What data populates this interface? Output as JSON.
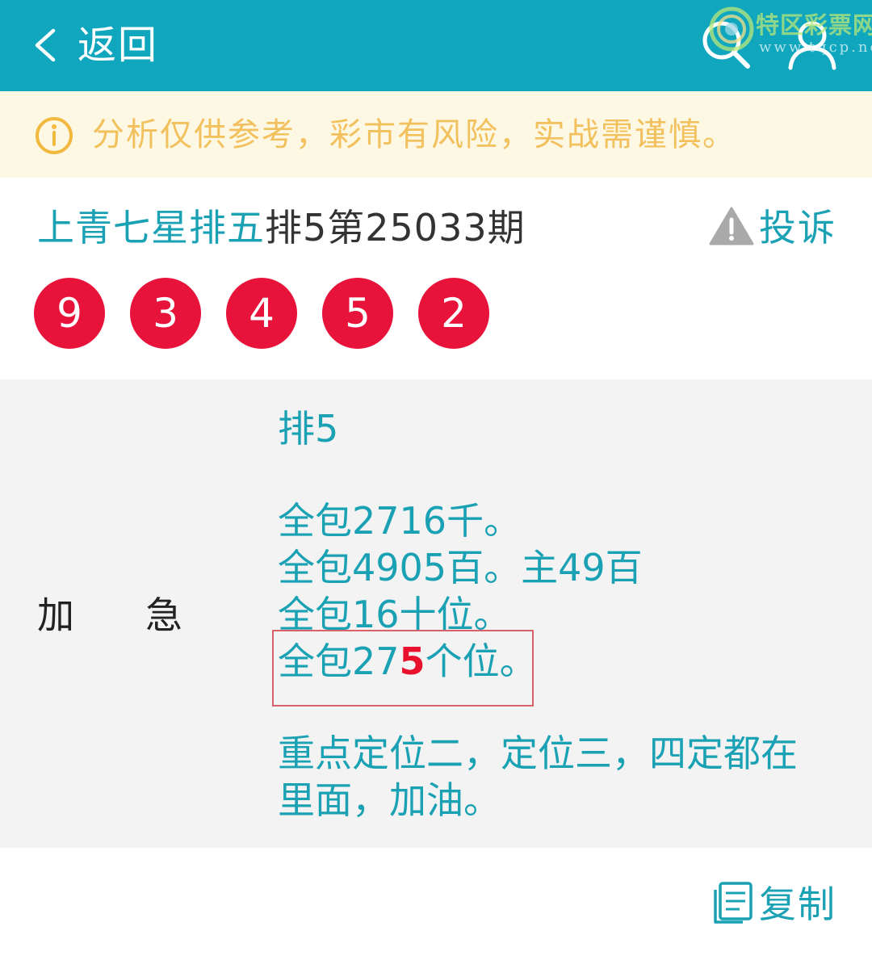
{
  "header": {
    "back_label": "返回",
    "icons": [
      "chevron-left-icon",
      "search-icon",
      "user-icon"
    ],
    "watermark": {
      "name": "特区彩票网",
      "url": "www.tqcp.net"
    },
    "color": "#10a6bd"
  },
  "notice": {
    "icon": "info-circle-icon",
    "text": "分析仅供参考，彩市有风险，实战需谨慎。",
    "color": "#f2c15e"
  },
  "post": {
    "master": "上青七星排五",
    "period": "排5第25033期",
    "complaint_label": "投诉",
    "balls": [
      "9",
      "3",
      "4",
      "5",
      "2"
    ],
    "ball_color": "#e8133a"
  },
  "content": {
    "label_left": "加",
    "label_right": "急",
    "heading": "排5",
    "lines": [
      "全包2716千。",
      "全包4905百。主49百",
      "全包16十位。"
    ],
    "highlight_line": {
      "before": "全包27",
      "highlight": "5",
      "after": "个位。"
    },
    "summary_line1": "重点定位二，定位三，四定都在",
    "summary_line2": "里面，加油。"
  },
  "footer": {
    "copy_label": "复制"
  }
}
